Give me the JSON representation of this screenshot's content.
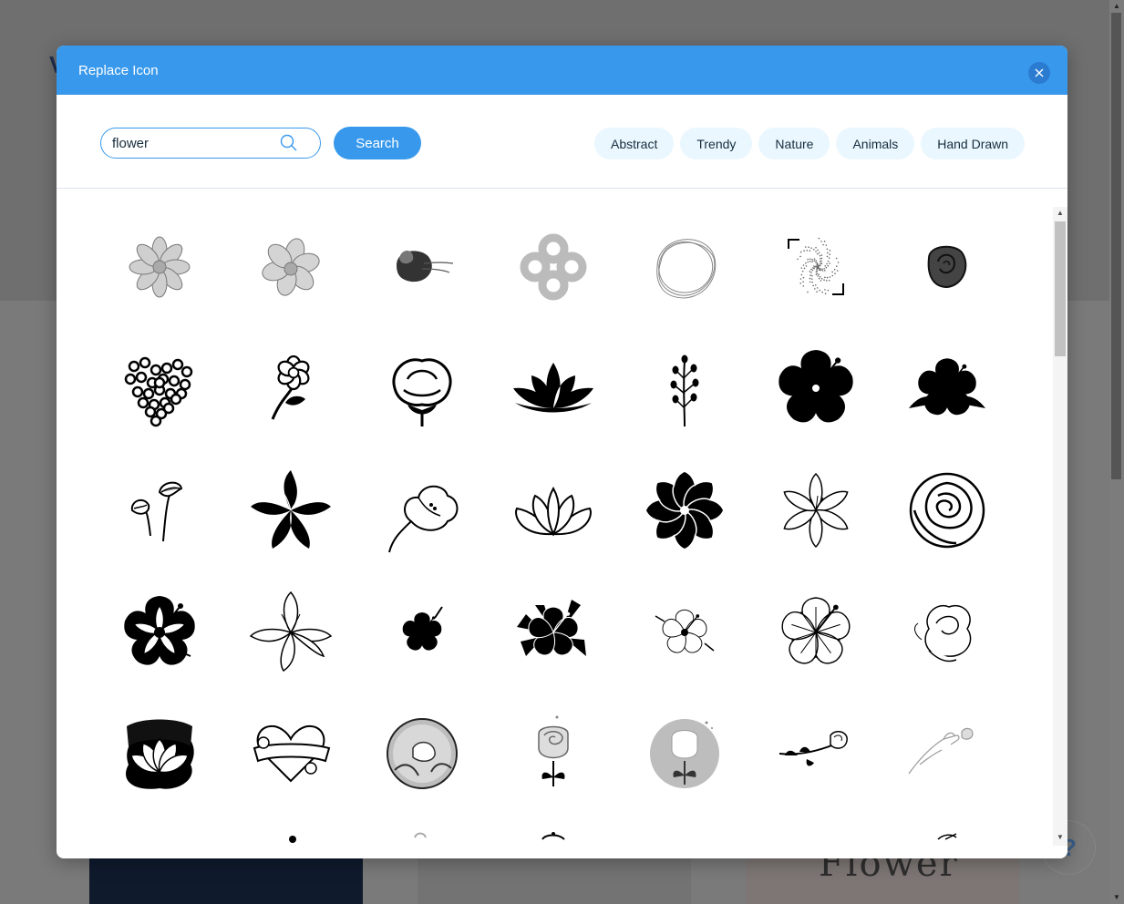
{
  "dialog": {
    "title": "Replace Icon",
    "close_icon": "close-icon"
  },
  "search": {
    "value": "flower",
    "button_label": "Search",
    "icon": "search-icon"
  },
  "categories": [
    "Abstract",
    "Trendy",
    "Nature",
    "Animals",
    "Hand Drawn"
  ],
  "colors": {
    "header": "#3899ec",
    "chip_bg": "#eaf7ff",
    "text": "#162d3d"
  },
  "icons": [
    [
      "cosmos-flower-gray-icon",
      "cosmos-flower-gray-2-icon",
      "brush-stroke-blob-icon",
      "gray-clover-icon",
      "scribble-circle-icon",
      "dotted-frame-icon",
      "rose-swirl-icon"
    ],
    [
      "flower-heart-icon",
      "curved-stem-flower-icon",
      "cotton-flower-icon",
      "lotus-black-icon",
      "sprig-icon",
      "hibiscus-large-icon",
      "hibiscus-leaves-icon"
    ],
    [
      "calla-lily-icon",
      "lily-black-icon",
      "lily-outline-icon",
      "lotus-outline-icon",
      "mandala-flower-icon",
      "lily-line-icon",
      "rose-outline-icon"
    ],
    [
      "hibiscus-bold-icon",
      "lily-sketch-icon",
      "hibiscus-small-icon",
      "tropical-bouquet-icon",
      "hibiscus-thin-icon",
      "hibiscus-line-icon",
      "rose-sketch-icon"
    ],
    [
      "lotus-pad-icon",
      "heart-banner-icon",
      "bird-badge-icon",
      "tulip-rose-icon",
      "rose-circle-badge-icon",
      "rose-branch-icon",
      "hand-flower-icon"
    ],
    [
      "partial-icon-1",
      "partial-icon-2",
      "partial-icon-3",
      "partial-icon-4",
      "partial-icon-5",
      "partial-icon-6",
      "partial-icon-7"
    ]
  ],
  "background": {
    "card_text": "Flower",
    "help_label": "?"
  }
}
